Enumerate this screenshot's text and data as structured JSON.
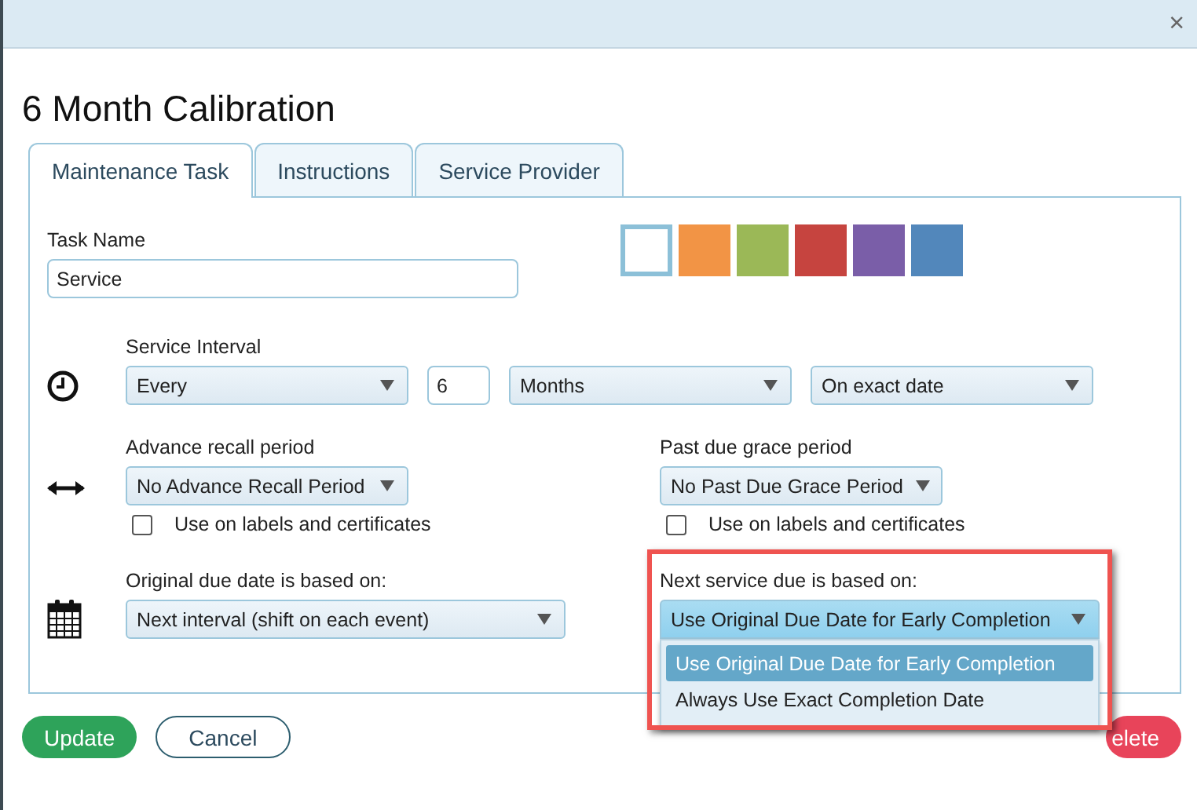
{
  "dialog": {
    "close": "×",
    "title": "6 Month Calibration"
  },
  "tabs": [
    {
      "label": "Maintenance Task",
      "selected": true
    },
    {
      "label": "Instructions",
      "selected": false
    },
    {
      "label": "Service Provider",
      "selected": false
    }
  ],
  "task_name": {
    "label": "Task Name",
    "value": "Service"
  },
  "colors": [
    {
      "color": "#ffffff",
      "selected": true
    },
    {
      "color": "#f29445",
      "selected": false
    },
    {
      "color": "#9bb857",
      "selected": false
    },
    {
      "color": "#c6443f",
      "selected": false
    },
    {
      "color": "#7a5ea8",
      "selected": false
    },
    {
      "color": "#5287bb",
      "selected": false
    }
  ],
  "service_interval": {
    "label": "Service Interval",
    "mode": "Every",
    "count": "6",
    "unit": "Months",
    "timing": "On exact date"
  },
  "advance_recall": {
    "label": "Advance recall period",
    "value": "No Advance Recall Period",
    "checkbox": {
      "label": "Use on labels and certificates",
      "checked": false
    }
  },
  "past_due_grace": {
    "label": "Past due grace period",
    "value": "No Past Due Grace Period",
    "checkbox": {
      "label": "Use on labels and certificates",
      "checked": false
    }
  },
  "original_due": {
    "label": "Original due date is based on:",
    "value": "Next interval (shift on each event)"
  },
  "next_service_due": {
    "label": "Next service due is based on:",
    "value": "Use Original Due Date for Early Completion",
    "expanded": true,
    "highlighted": true,
    "options": [
      {
        "label": "Use Original Due Date for Early Completion",
        "selected": true
      },
      {
        "label": "Always Use Exact Completion Date",
        "selected": false
      }
    ]
  },
  "buttons": [
    {
      "label": "Update",
      "kind": "primary"
    },
    {
      "label": "Cancel",
      "kind": "secondary"
    },
    {
      "label": "elete",
      "kind": "danger"
    }
  ]
}
